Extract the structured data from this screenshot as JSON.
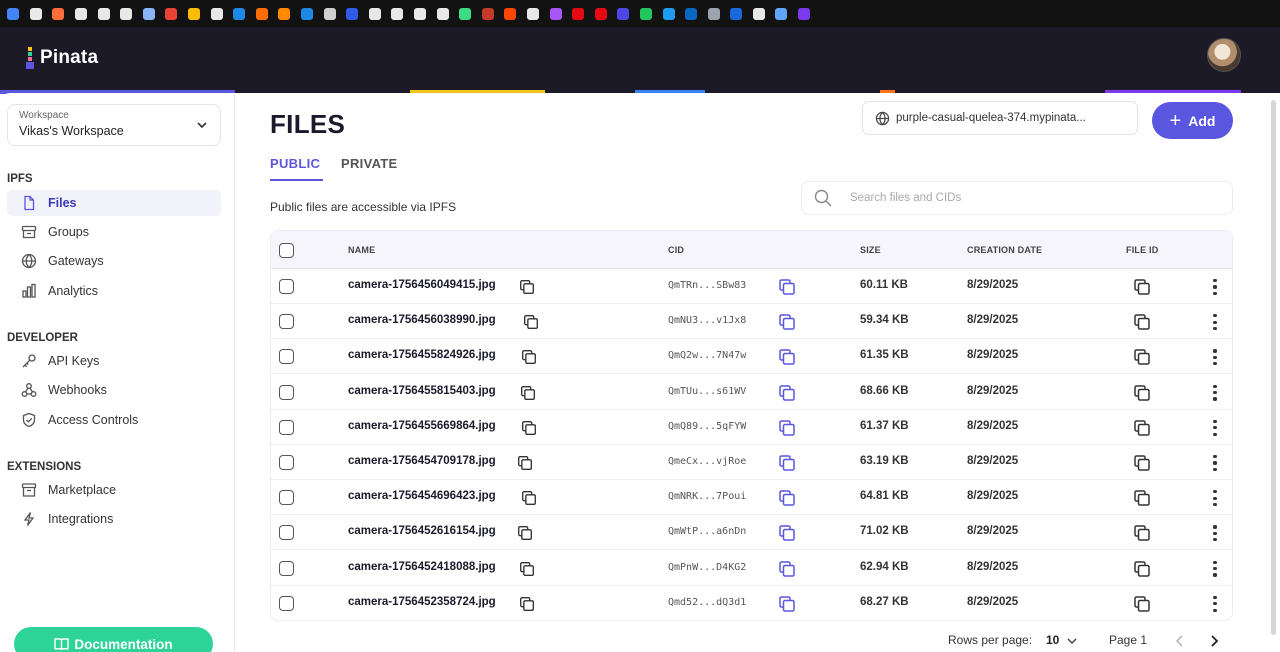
{
  "bookmarks": {
    "colors": [
      "#4285f4",
      "#e8e8e8",
      "#ff6d3a",
      "#e8e8e8",
      "#e8e8e8",
      "#e8e8e8",
      "#8ab4f8",
      "#ea4335",
      "#fbbc05",
      "#e8e8e8",
      "#1e88e5",
      "#ff6d00",
      "#ff8a00",
      "#1e88e5",
      "#d0d0d0",
      "#2f5bea",
      "#e8e8e8",
      "#e8e8e8",
      "#e8e8e8",
      "#e8e8e8",
      "#3ddc84",
      "#c0392b",
      "#ff4500",
      "#e8e8e8",
      "#a855f7",
      "#e50914",
      "#e50914",
      "#4f46e5",
      "#22c55e",
      "#1d9bf0",
      "#0a66c2",
      "#9ca3af",
      "#1868db",
      "#e8e8e8",
      "#60a5fa",
      "#7c3aed"
    ]
  },
  "header": {
    "logo_text": "Pinata",
    "avatar_icon": "avatar-icon",
    "accent_colors": [
      "#5b56e0",
      "#f5c518",
      "#3b82f6",
      "#f97316",
      "#7c3aed"
    ]
  },
  "sidebar": {
    "workspace_label": "Workspace",
    "workspace_name": "Vikas's Workspace",
    "sections": {
      "ipfs": "IPFS",
      "developer": "DEVELOPER",
      "extensions": "EXTENSIONS"
    },
    "items": [
      {
        "label": "Files",
        "icon": "file-icon",
        "active": true
      },
      {
        "label": "Groups",
        "icon": "archive-icon"
      },
      {
        "label": "Gateways",
        "icon": "globe-icon"
      },
      {
        "label": "Analytics",
        "icon": "bar-chart-icon"
      },
      {
        "label": "API Keys",
        "icon": "key-icon"
      },
      {
        "label": "Webhooks",
        "icon": "webhook-icon"
      },
      {
        "label": "Access Controls",
        "icon": "shield-icon"
      },
      {
        "label": "Marketplace",
        "icon": "store-icon"
      },
      {
        "label": "Integrations",
        "icon": "plug-icon"
      }
    ],
    "docs_label": "Documentation"
  },
  "main": {
    "title": "FILES",
    "gateway": "purple-casual-quelea-374.mypinata...",
    "add_label": "Add",
    "tabs": [
      "PUBLIC",
      "PRIVATE"
    ],
    "public_note": "Public files are accessible via IPFS",
    "search_placeholder": "Search files and CIDs",
    "columns": [
      "NAME",
      "CID",
      "SIZE",
      "CREATION DATE",
      "FILE ID"
    ],
    "rows": [
      {
        "name": "camera-1756456049415.jpg",
        "cid": "QmTRn...SBw83",
        "size": "60.11 KB",
        "date": "8/29/2025"
      },
      {
        "name": "camera-1756456038990.jpg",
        "cid": "QmNU3...v1Jx8",
        "size": "59.34 KB",
        "date": "8/29/2025"
      },
      {
        "name": "camera-1756455824926.jpg",
        "cid": "QmQ2w...7N47w",
        "size": "61.35 KB",
        "date": "8/29/2025"
      },
      {
        "name": "camera-1756455815403.jpg",
        "cid": "QmTUu...s61WV",
        "size": "68.66 KB",
        "date": "8/29/2025"
      },
      {
        "name": "camera-1756455669864.jpg",
        "cid": "QmQ89...5qFYW",
        "size": "61.37 KB",
        "date": "8/29/2025"
      },
      {
        "name": "camera-1756454709178.jpg",
        "cid": "QmeCx...vjRoe",
        "size": "63.19 KB",
        "date": "8/29/2025"
      },
      {
        "name": "camera-1756454696423.jpg",
        "cid": "QmNRK...7Poui",
        "size": "64.81 KB",
        "date": "8/29/2025"
      },
      {
        "name": "camera-1756452616154.jpg",
        "cid": "QmWtP...a6nDn",
        "size": "71.02 KB",
        "date": "8/29/2025"
      },
      {
        "name": "camera-1756452418088.jpg",
        "cid": "QmPnW...D4KG2",
        "size": "62.94 KB",
        "date": "8/29/2025"
      },
      {
        "name": "camera-1756452358724.jpg",
        "cid": "Qmd52...dQ3d1",
        "size": "68.27 KB",
        "date": "8/29/2025"
      }
    ],
    "pagination": {
      "rows_per_page_label": "Rows per page:",
      "rows_per_page": "10",
      "page_label": "Page 1"
    }
  },
  "colors": {
    "accent": "#5b56e0",
    "docs": "#2ed397",
    "header_bg": "#1b1a26"
  }
}
